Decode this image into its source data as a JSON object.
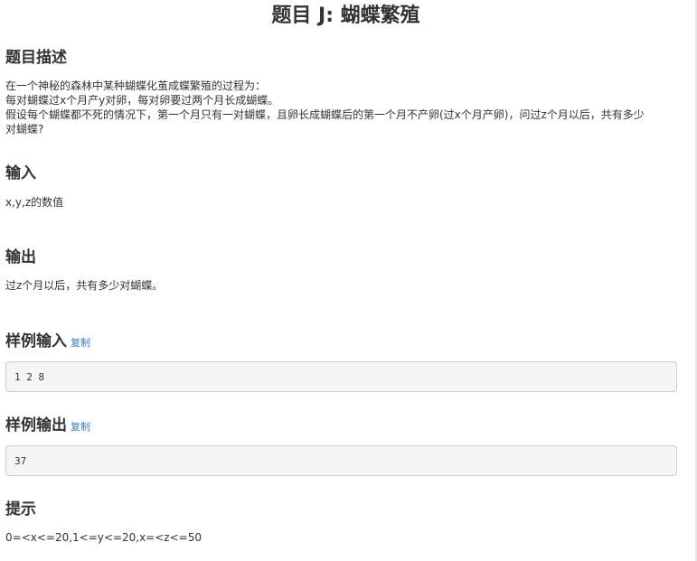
{
  "problem": {
    "title": "题目 J: 蝴蝶繁殖"
  },
  "sections": {
    "description": {
      "heading": "题目描述",
      "lines": [
        "在一个神秘的森林中某种蝴蝶化茧成蝶繁殖的过程为：",
        "每对蝴蝶过x个月产y对卵，每对卵要过两个月长成蝴蝶。",
        "假设每个蝴蝶都不死的情况下，第一个月只有一对蝴蝶，且卵长成蝴蝶后的第一个月不产卵(过x个月产卵)，问过z个月以后，共有多少",
        "对蝴蝶?"
      ]
    },
    "input": {
      "heading": "输入",
      "text": "x,y,z的数值"
    },
    "output": {
      "heading": "输出",
      "text": "过z个月以后，共有多少对蝴蝶。"
    },
    "sample_input": {
      "heading": "样例输入",
      "copy_label": "复制",
      "value": "1 2 8"
    },
    "sample_output": {
      "heading": "样例输出",
      "copy_label": "复制",
      "value": "37"
    },
    "hint": {
      "heading": "提示",
      "text": "0=<x<=20,1<=y<=20,x=<z<=50"
    }
  }
}
